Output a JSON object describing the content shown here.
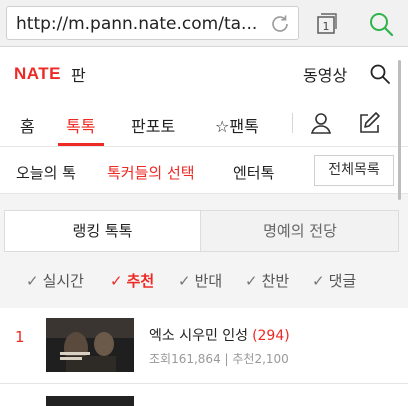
{
  "browser": {
    "url": "http://m.pann.nate.com/ta...",
    "tab_count": "1"
  },
  "header": {
    "logo_text": "NATE",
    "logo_sub": "판",
    "video_link": "동영상"
  },
  "main_nav": {
    "items": [
      {
        "label": "홈",
        "active": false
      },
      {
        "label": "톡톡",
        "active": true
      },
      {
        "label": "판포토",
        "active": false
      },
      {
        "label": "☆팬톡",
        "active": false
      }
    ]
  },
  "sub_nav": {
    "items": [
      {
        "label": "오늘의 톡",
        "active": false
      },
      {
        "label": "톡커들의 선택",
        "active": true
      },
      {
        "label": "엔터톡",
        "active": false
      }
    ],
    "all_list_label": "전체목록"
  },
  "segment_tabs": {
    "active_label": "랭킹 톡톡",
    "inactive_label": "명예의 전당"
  },
  "filters": {
    "check_mark": "✓",
    "items": [
      {
        "label": "실시간",
        "active": false
      },
      {
        "label": "추천",
        "active": true
      },
      {
        "label": "반대",
        "active": false
      },
      {
        "label": "찬반",
        "active": false
      },
      {
        "label": "댓글",
        "active": false
      }
    ]
  },
  "list": {
    "items": [
      {
        "rank": "1",
        "title": "엑소 시우민 인성",
        "comment_count": "(294)",
        "meta": "조회161,864 | 추천2,100"
      }
    ]
  },
  "colors": {
    "accent": "#ee2a24",
    "search_green": "#2fb34a"
  }
}
